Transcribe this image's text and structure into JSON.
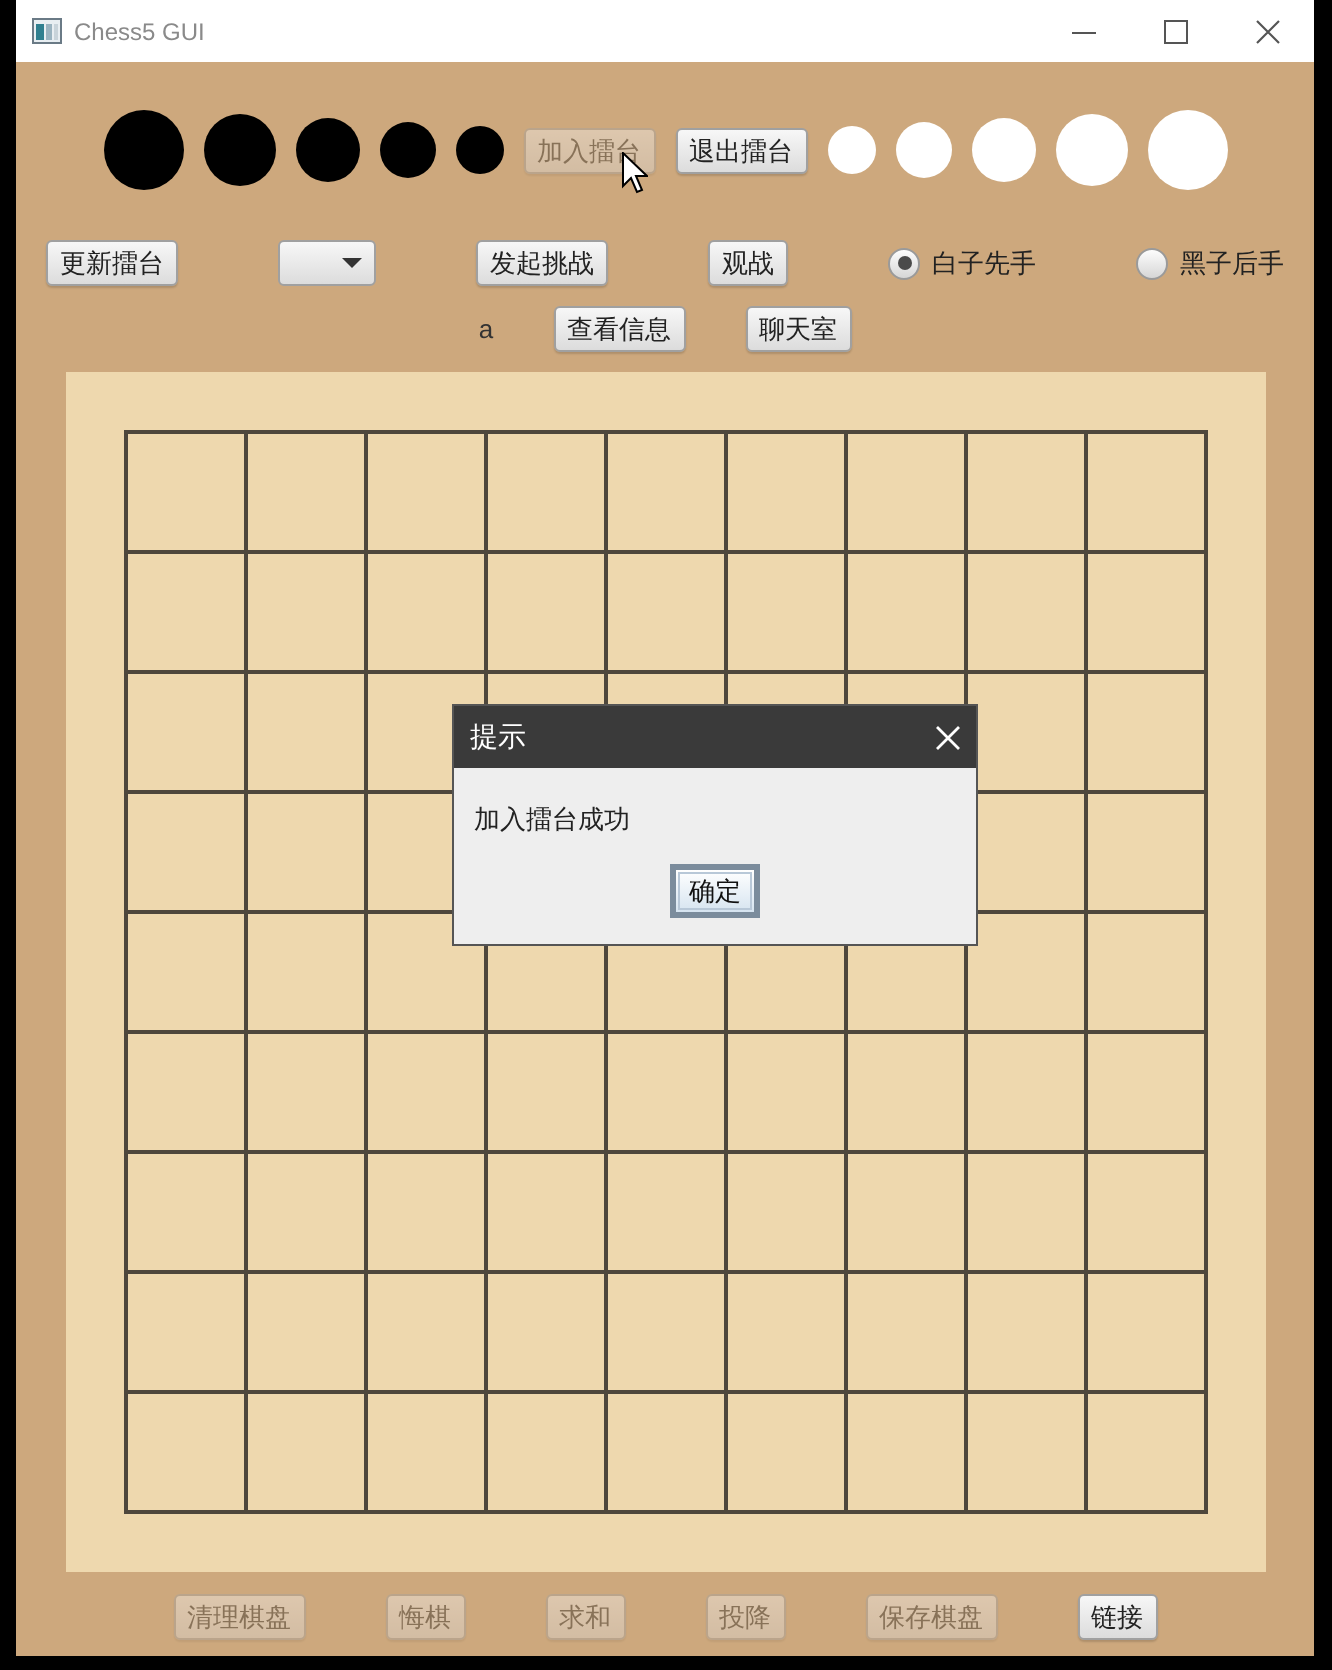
{
  "window": {
    "title": "Chess5 GUI"
  },
  "arena_buttons": [
    {
      "label": "加入擂台",
      "disabled": true
    },
    {
      "label": "退出擂台",
      "disabled": false
    }
  ],
  "toolbar": [
    {
      "kind": "button",
      "label": "更新擂台",
      "disabled": false
    },
    {
      "kind": "dropdown"
    },
    {
      "kind": "button",
      "label": "发起挑战",
      "disabled": false
    },
    {
      "kind": "button",
      "label": "观战",
      "disabled": false
    },
    {
      "kind": "radio",
      "label": "白子先手",
      "selected": true
    },
    {
      "kind": "radio",
      "label": "黑子后手",
      "selected": false
    }
  ],
  "info_row": [
    {
      "kind": "label",
      "text": "a"
    },
    {
      "kind": "button",
      "label": "查看信息",
      "disabled": false
    },
    {
      "kind": "button",
      "label": "聊天室",
      "disabled": false
    }
  ],
  "dialog": {
    "title": "提示",
    "message": "加入擂台成功",
    "button": "确定"
  },
  "game_buttons": [
    {
      "label": "清理棋盘",
      "disabled": true
    },
    {
      "label": "悔棋",
      "disabled": true
    },
    {
      "label": "求和",
      "disabled": true
    },
    {
      "label": "投降",
      "disabled": true
    },
    {
      "label": "保存棋盘",
      "disabled": true
    },
    {
      "label": "链接",
      "disabled": false
    }
  ]
}
